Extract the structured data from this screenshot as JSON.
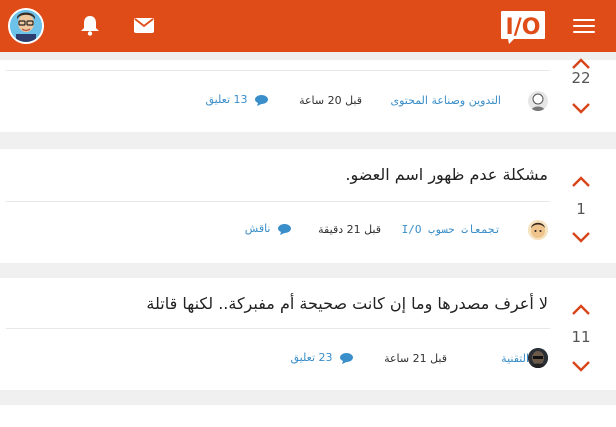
{
  "header": {
    "logo_text": "I/O",
    "colors": {
      "bar": "#e04c17",
      "icon": "#ffffff"
    },
    "icons": [
      "menu-icon",
      "logo",
      "envelope-icon",
      "bell-icon",
      "user-avatar"
    ]
  },
  "posts": [
    {
      "votes": "22",
      "category": "التدوين وصناعة المحتوى",
      "time": "قبل 20 ساعة",
      "comments": "13 تعليق"
    },
    {
      "title": "مشكلة عدم ظهور اسم العضو.",
      "votes": "1",
      "category": "تجمعات حسوب I/O",
      "time": "قبل 21 دقيقة",
      "comments": "ناقش"
    },
    {
      "title": "لا أعرف مصدرها وما إن كانت صحيحة أم مفبركة.. لكنها قاتلة",
      "votes": "11",
      "category": "التقنية",
      "time": "قبل 21 ساعة",
      "comments": "23 تعليق"
    }
  ],
  "colors": {
    "accent": "#e04c17",
    "link": "#3a8ec9",
    "background": "#f0f0f0"
  }
}
